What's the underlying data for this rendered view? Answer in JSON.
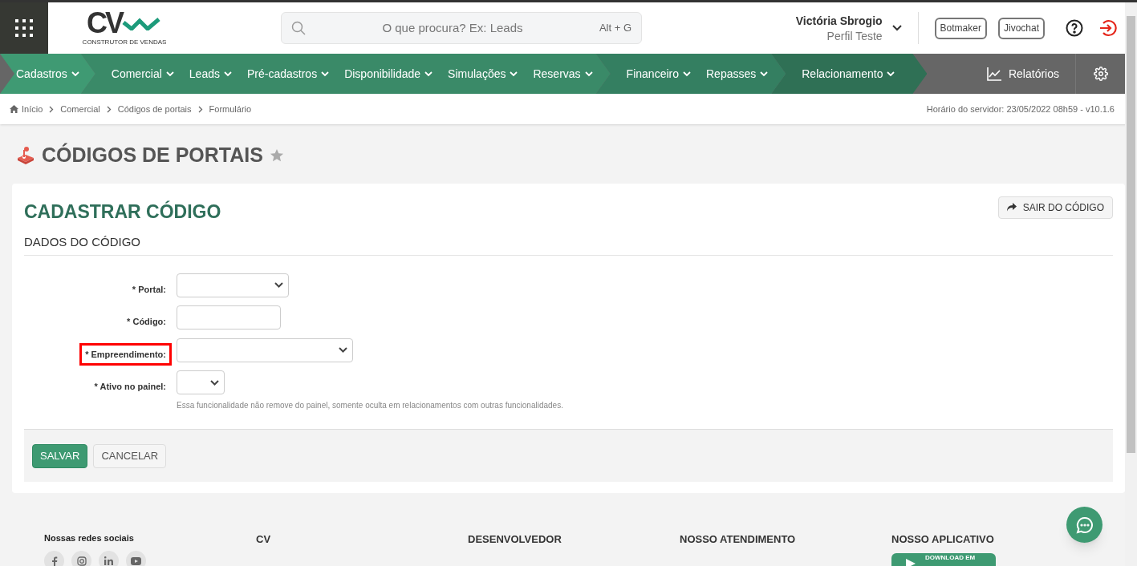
{
  "header": {
    "search": {
      "placeholder": "O que procura? Ex: Leads",
      "shortcut": "Alt + G"
    },
    "logo": {
      "text": "CV",
      "tagline": "CONSTRUTOR DE VENDAS"
    },
    "user": {
      "name": "Victória Sbrogio",
      "profile": "Perfil Teste"
    },
    "buttons": [
      "Botmaker",
      "Jivochat"
    ]
  },
  "nav": {
    "groups": [
      {
        "color": "#3f9a73",
        "items": [
          "Cadastros"
        ]
      },
      {
        "color": "#3a8a68",
        "items": [
          "Comercial",
          "Leads",
          "Pré-cadastros",
          "Disponibilidade",
          "Simulações",
          "Reservas"
        ]
      },
      {
        "color": "#347f61",
        "items": [
          "Financeiro",
          "Repasses"
        ]
      },
      {
        "color": "#2f7055",
        "items": [
          "Relacionamento"
        ]
      }
    ],
    "reports": "Relatórios"
  },
  "breadcrumb": [
    "Início",
    "Comercial",
    "Códigos de portais",
    "Formulário"
  ],
  "server_time": "Horário do servidor: 23/05/2022 08h59 - v10.1.6",
  "page_title": "CÓDIGOS DE PORTAIS",
  "card": {
    "title": "CADASTRAR CÓDIGO",
    "exit_button": "SAIR DO CÓDIGO",
    "section": "DADOS DO CÓDIGO",
    "fields": [
      {
        "kind": "select",
        "label": "* Portal:",
        "highlighted": false
      },
      {
        "kind": "text",
        "label": "* Código:",
        "highlighted": false
      },
      {
        "kind": "select",
        "label": "* Empreendimento:",
        "highlighted": true
      },
      {
        "kind": "select",
        "label": "* Ativo no painel:",
        "highlighted": false,
        "help": "Essa funcionalidade não remove do painel, somente oculta em relacionamentos com outras funcionalidades."
      }
    ],
    "save": "SALVAR",
    "cancel": "CANCELAR"
  },
  "footer": {
    "social_title": "Nossas redes sociais",
    "columns": [
      "CV",
      "DESENVOLVEDOR",
      "NOSSO ATENDIMENTO",
      "NOSSO APLICATIVO"
    ],
    "app_badge": "DOWNLOAD EM"
  }
}
